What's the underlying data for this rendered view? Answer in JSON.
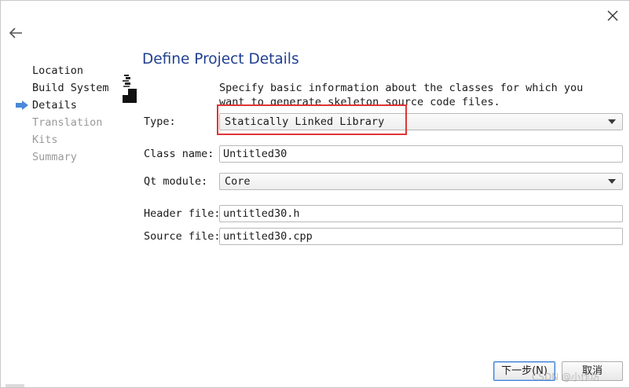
{
  "nav": {
    "back_icon": "arrow-left-icon",
    "close_icon": "close-icon",
    "current_step_icon": "arrow-right-icon",
    "current_step_color": "#4a88d8",
    "steps": [
      {
        "label": "Location",
        "state": "done"
      },
      {
        "label": "Build System",
        "state": "done"
      },
      {
        "label": "Details",
        "state": "current"
      },
      {
        "label": "Translation",
        "state": "todo"
      },
      {
        "label": "Kits",
        "state": "todo"
      },
      {
        "label": "Summary",
        "state": "todo"
      }
    ]
  },
  "page": {
    "title": "Define Project Details",
    "title_color": "#1f3f8f",
    "description": "Specify basic information about the classes for which you want to generate skeleton source code files."
  },
  "form": {
    "type": {
      "label": "Type:",
      "value": "Statically Linked Library"
    },
    "class_name": {
      "label": "Class name:",
      "value": "Untitled30"
    },
    "qt_module": {
      "label": "Qt module:",
      "value": "Core"
    },
    "header_file": {
      "label": "Header file:",
      "value": "untitled30.h"
    },
    "source_file": {
      "label": "Source file:",
      "value": "untitled30.cpp"
    }
  },
  "annotation": {
    "highlight_color": "#e03535"
  },
  "footer": {
    "next_label": "下一步(N)",
    "cancel_label": "取消"
  },
  "watermark": {
    "text": "CSDN @小作坊"
  }
}
